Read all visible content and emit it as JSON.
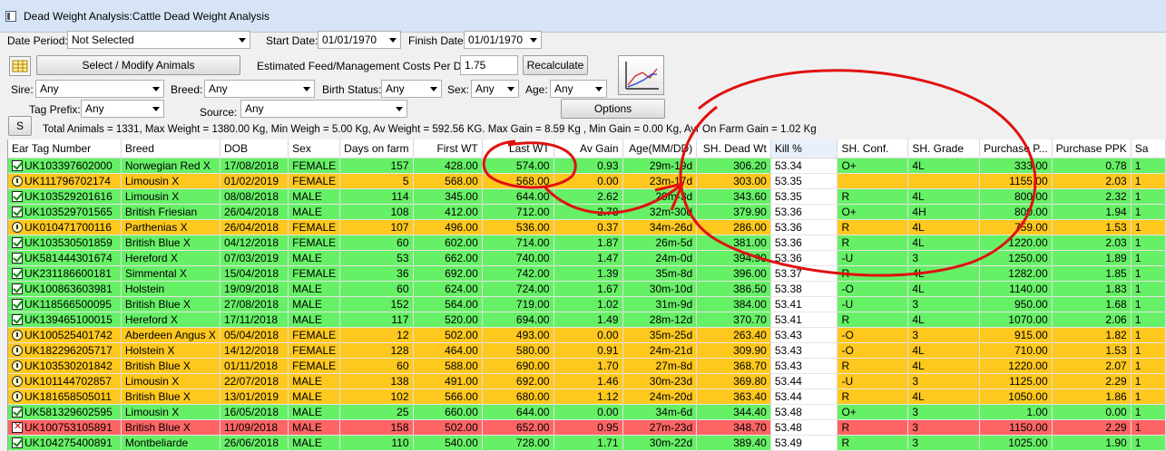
{
  "window": {
    "title": "Dead Weight Analysis:Cattle Dead Weight Analysis"
  },
  "filters": {
    "date_period_label": "Date Period:",
    "date_period_value": "Not Selected",
    "start_date_label": "Start Date:",
    "start_date_value": "01/01/1970",
    "finish_date_label": "Finish Date:",
    "finish_date_value": "01/01/1970",
    "sire_label": "Sire:",
    "sire_value": "Any",
    "breed_label": "Breed:",
    "breed_value": "Any",
    "birth_status_label": "Birth Status:",
    "birth_status_value": "Any",
    "sex_label": "Sex:",
    "sex_value": "Any",
    "age_label": "Age:",
    "age_value": "Any",
    "tag_prefix_label": "Tag Prefix:",
    "tag_prefix_value": "Any",
    "source_label": "Source:",
    "source_value": "Any"
  },
  "toolbar": {
    "select_animals_label": "Select / Modify Animals",
    "feed_cost_label": "Estimated Feed/Management Costs Per Day:",
    "feed_cost_value": "1.75",
    "recalculate_label": "Recalculate",
    "options_label": "Options",
    "s_label": "S"
  },
  "summary": "Total Animals = 1331, Max Weight = 1380.00 Kg, Min Weigh = 5.00 Kg, Av Weight = 592.56 KG. Max Gain = 8.59 Kg , Min Gain = 0.00 Kg, Avr On Farm Gain = 1.02 Kg",
  "columns": [
    "Ear Tag Number",
    "Breed",
    "DOB",
    "Sex",
    "Days on farm",
    "First WT",
    "Last WT",
    "Av Gain",
    "Age(MM/DD)",
    "SH. Dead Wt",
    "Kill %",
    "SH. Conf.",
    "SH. Grade",
    "Purchase P...",
    "Purchase PPK",
    "Sa"
  ],
  "rows": [
    {
      "status": "green",
      "icon": "check",
      "tag": "UK103397602000",
      "breed": "Norwegian Red X",
      "dob": "17/08/2018",
      "sex": "FEMALE",
      "days": "157",
      "first": "428.00",
      "last": "574.00",
      "gain": "0.93",
      "age": "29m-19d",
      "dead": "306.20",
      "kill": "53.34",
      "conf": "O+",
      "grade": "4L",
      "pp": "333.00",
      "ppk": "0.78",
      "sa": "1"
    },
    {
      "status": "orange",
      "icon": "clock",
      "tag": "UK111796702174",
      "breed": "Limousin X",
      "dob": "01/02/2019",
      "sex": "FEMALE",
      "days": "5",
      "first": "568.00",
      "last": "568.00",
      "gain": "0.00",
      "age": "23m-17d",
      "dead": "303.00",
      "kill": "53.35",
      "conf": "",
      "grade": "",
      "pp": "1155.00",
      "ppk": "2.03",
      "sa": "1"
    },
    {
      "status": "green",
      "icon": "check",
      "tag": "UK103529201616",
      "breed": "Limousin X",
      "dob": "08/08/2018",
      "sex": "MALE",
      "days": "114",
      "first": "345.00",
      "last": "644.00",
      "gain": "2.62",
      "age": "29m-3d",
      "dead": "343.60",
      "kill": "53.35",
      "conf": "R",
      "grade": "4L",
      "pp": "800.00",
      "ppk": "2.32",
      "sa": "1"
    },
    {
      "status": "green",
      "icon": "check",
      "tag": "UK103529701565",
      "breed": "British Friesian",
      "dob": "26/04/2018",
      "sex": "MALE",
      "days": "108",
      "first": "412.00",
      "last": "712.00",
      "gain": "2.78",
      "age": "32m-30d",
      "dead": "379.90",
      "kill": "53.36",
      "conf": "O+",
      "grade": "4H",
      "pp": "800.00",
      "ppk": "1.94",
      "sa": "1"
    },
    {
      "status": "orange",
      "icon": "clock",
      "tag": "UK010471700116",
      "breed": "Parthenias X",
      "dob": "26/04/2018",
      "sex": "FEMALE",
      "days": "107",
      "first": "496.00",
      "last": "536.00",
      "gain": "0.37",
      "age": "34m-26d",
      "dead": "286.00",
      "kill": "53.36",
      "conf": "R",
      "grade": "4L",
      "pp": "759.00",
      "ppk": "1.53",
      "sa": "1"
    },
    {
      "status": "green",
      "icon": "check",
      "tag": "UK103530501859",
      "breed": "British Blue X",
      "dob": "04/12/2018",
      "sex": "FEMALE",
      "days": "60",
      "first": "602.00",
      "last": "714.00",
      "gain": "1.87",
      "age": "26m-5d",
      "dead": "381.00",
      "kill": "53.36",
      "conf": "R",
      "grade": "4L",
      "pp": "1220.00",
      "ppk": "2.03",
      "sa": "1"
    },
    {
      "status": "green",
      "icon": "check",
      "tag": "UK581444301674",
      "breed": "Hereford X",
      "dob": "07/03/2019",
      "sex": "MALE",
      "days": "53",
      "first": "662.00",
      "last": "740.00",
      "gain": "1.47",
      "age": "24m-0d",
      "dead": "394.90",
      "kill": "53.36",
      "conf": "-U",
      "grade": "3",
      "pp": "1250.00",
      "ppk": "1.89",
      "sa": "1"
    },
    {
      "status": "green",
      "icon": "check",
      "tag": "UK231186600181",
      "breed": "Simmental X",
      "dob": "15/04/2018",
      "sex": "FEMALE",
      "days": "36",
      "first": "692.00",
      "last": "742.00",
      "gain": "1.39",
      "age": "35m-8d",
      "dead": "396.00",
      "kill": "53.37",
      "conf": "R",
      "grade": "4L",
      "pp": "1282.00",
      "ppk": "1.85",
      "sa": "1"
    },
    {
      "status": "green",
      "icon": "check",
      "tag": "UK100863603981",
      "breed": "Holstein",
      "dob": "19/09/2018",
      "sex": "MALE",
      "days": "60",
      "first": "624.00",
      "last": "724.00",
      "gain": "1.67",
      "age": "30m-10d",
      "dead": "386.50",
      "kill": "53.38",
      "conf": "-O",
      "grade": "4L",
      "pp": "1140.00",
      "ppk": "1.83",
      "sa": "1"
    },
    {
      "status": "green",
      "icon": "check",
      "tag": "UK118566500095",
      "breed": "British Blue X",
      "dob": "27/08/2018",
      "sex": "MALE",
      "days": "152",
      "first": "564.00",
      "last": "719.00",
      "gain": "1.02",
      "age": "31m-9d",
      "dead": "384.00",
      "kill": "53.41",
      "conf": "-U",
      "grade": "3",
      "pp": "950.00",
      "ppk": "1.68",
      "sa": "1"
    },
    {
      "status": "green",
      "icon": "check",
      "tag": "UK139465100015",
      "breed": "Hereford X",
      "dob": "17/11/2018",
      "sex": "MALE",
      "days": "117",
      "first": "520.00",
      "last": "694.00",
      "gain": "1.49",
      "age": "28m-12d",
      "dead": "370.70",
      "kill": "53.41",
      "conf": "R",
      "grade": "4L",
      "pp": "1070.00",
      "ppk": "2.06",
      "sa": "1"
    },
    {
      "status": "orange",
      "icon": "clock",
      "tag": "UK100525401742",
      "breed": "Aberdeen Angus X",
      "dob": "05/04/2018",
      "sex": "FEMALE",
      "days": "12",
      "first": "502.00",
      "last": "493.00",
      "gain": "0.00",
      "age": "35m-25d",
      "dead": "263.40",
      "kill": "53.43",
      "conf": "-O",
      "grade": "3",
      "pp": "915.00",
      "ppk": "1.82",
      "sa": "1"
    },
    {
      "status": "orange",
      "icon": "clock",
      "tag": "UK182296205717",
      "breed": "Holstein X",
      "dob": "14/12/2018",
      "sex": "FEMALE",
      "days": "128",
      "first": "464.00",
      "last": "580.00",
      "gain": "0.91",
      "age": "24m-21d",
      "dead": "309.90",
      "kill": "53.43",
      "conf": "-O",
      "grade": "4L",
      "pp": "710.00",
      "ppk": "1.53",
      "sa": "1"
    },
    {
      "status": "orange",
      "icon": "clock",
      "tag": "UK103530201842",
      "breed": "British Blue X",
      "dob": "01/11/2018",
      "sex": "FEMALE",
      "days": "60",
      "first": "588.00",
      "last": "690.00",
      "gain": "1.70",
      "age": "27m-8d",
      "dead": "368.70",
      "kill": "53.43",
      "conf": "R",
      "grade": "4L",
      "pp": "1220.00",
      "ppk": "2.07",
      "sa": "1"
    },
    {
      "status": "orange",
      "icon": "clock",
      "tag": "UK101144702857",
      "breed": "Limousin X",
      "dob": "22/07/2018",
      "sex": "MALE",
      "days": "138",
      "first": "491.00",
      "last": "692.00",
      "gain": "1.46",
      "age": "30m-23d",
      "dead": "369.80",
      "kill": "53.44",
      "conf": "-U",
      "grade": "3",
      "pp": "1125.00",
      "ppk": "2.29",
      "sa": "1"
    },
    {
      "status": "orange",
      "icon": "clock",
      "tag": "UK181658505011",
      "breed": "British Blue X",
      "dob": "13/01/2019",
      "sex": "MALE",
      "days": "102",
      "first": "566.00",
      "last": "680.00",
      "gain": "1.12",
      "age": "24m-20d",
      "dead": "363.40",
      "kill": "53.44",
      "conf": "R",
      "grade": "4L",
      "pp": "1050.00",
      "ppk": "1.86",
      "sa": "1"
    },
    {
      "status": "green",
      "icon": "check",
      "tag": "UK581329602595",
      "breed": "Limousin X",
      "dob": "16/05/2018",
      "sex": "MALE",
      "days": "25",
      "first": "660.00",
      "last": "644.00",
      "gain": "0.00",
      "age": "34m-6d",
      "dead": "344.40",
      "kill": "53.48",
      "conf": "O+",
      "grade": "3",
      "pp": "1.00",
      "ppk": "0.00",
      "sa": "1"
    },
    {
      "status": "red",
      "icon": "bad",
      "tag": "UK100753105891",
      "breed": "British Blue X",
      "dob": "11/09/2018",
      "sex": "MALE",
      "days": "158",
      "first": "502.00",
      "last": "652.00",
      "gain": "0.95",
      "age": "27m-23d",
      "dead": "348.70",
      "kill": "53.48",
      "conf": "R",
      "grade": "3",
      "pp": "1150.00",
      "ppk": "2.29",
      "sa": "1"
    },
    {
      "status": "green",
      "icon": "check",
      "tag": "UK104275400891",
      "breed": "Montbeliarde",
      "dob": "26/06/2018",
      "sex": "MALE",
      "days": "110",
      "first": "540.00",
      "last": "728.00",
      "gain": "1.71",
      "age": "30m-22d",
      "dead": "389.40",
      "kill": "53.49",
      "conf": "R",
      "grade": "3",
      "pp": "1025.00",
      "ppk": "1.90",
      "sa": "1"
    }
  ]
}
